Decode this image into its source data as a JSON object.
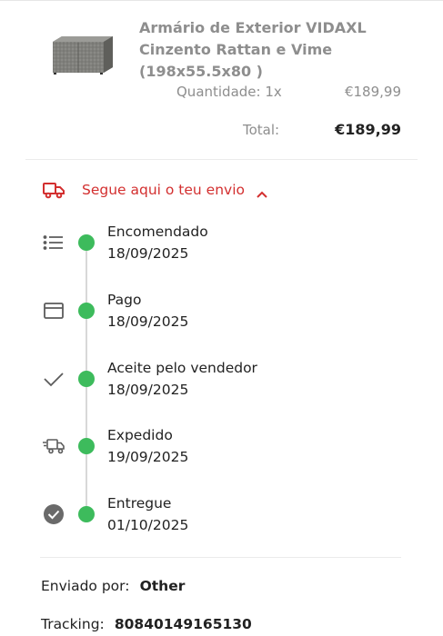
{
  "product": {
    "title_line1": "Armário de Exterior VIDAXL",
    "title_line2": "Cinzento Rattan e Vime",
    "title_line3": "(198x55.5x80 )",
    "quantity_label": "Quantidade: 1x",
    "price": "€189,99",
    "total_label": "Total:",
    "total_value": "€189,99"
  },
  "tracking_header": {
    "label": "Segue aqui o teu envio",
    "icon": "truck-icon",
    "toggle_icon": "chevron-up-icon",
    "color": "#d32f2f"
  },
  "timeline": {
    "dot_color": "#3dbb5c",
    "steps": [
      {
        "title": "Encomendado",
        "date": "18/09/2025",
        "icon": "list-icon"
      },
      {
        "title": "Pago",
        "date": "18/09/2025",
        "icon": "card-icon"
      },
      {
        "title": "Aceite pelo vendedor",
        "date": "18/09/2025",
        "icon": "check-icon"
      },
      {
        "title": "Expedido",
        "date": "19/09/2025",
        "icon": "fast-truck-icon"
      },
      {
        "title": "Entregue",
        "date": "01/10/2025",
        "icon": "check-circle-icon"
      }
    ]
  },
  "shipping": {
    "sent_by_label": "Enviado por:",
    "sent_by_value": "Other",
    "tracking_label": "Tracking:",
    "tracking_value": "80840149165130"
  }
}
